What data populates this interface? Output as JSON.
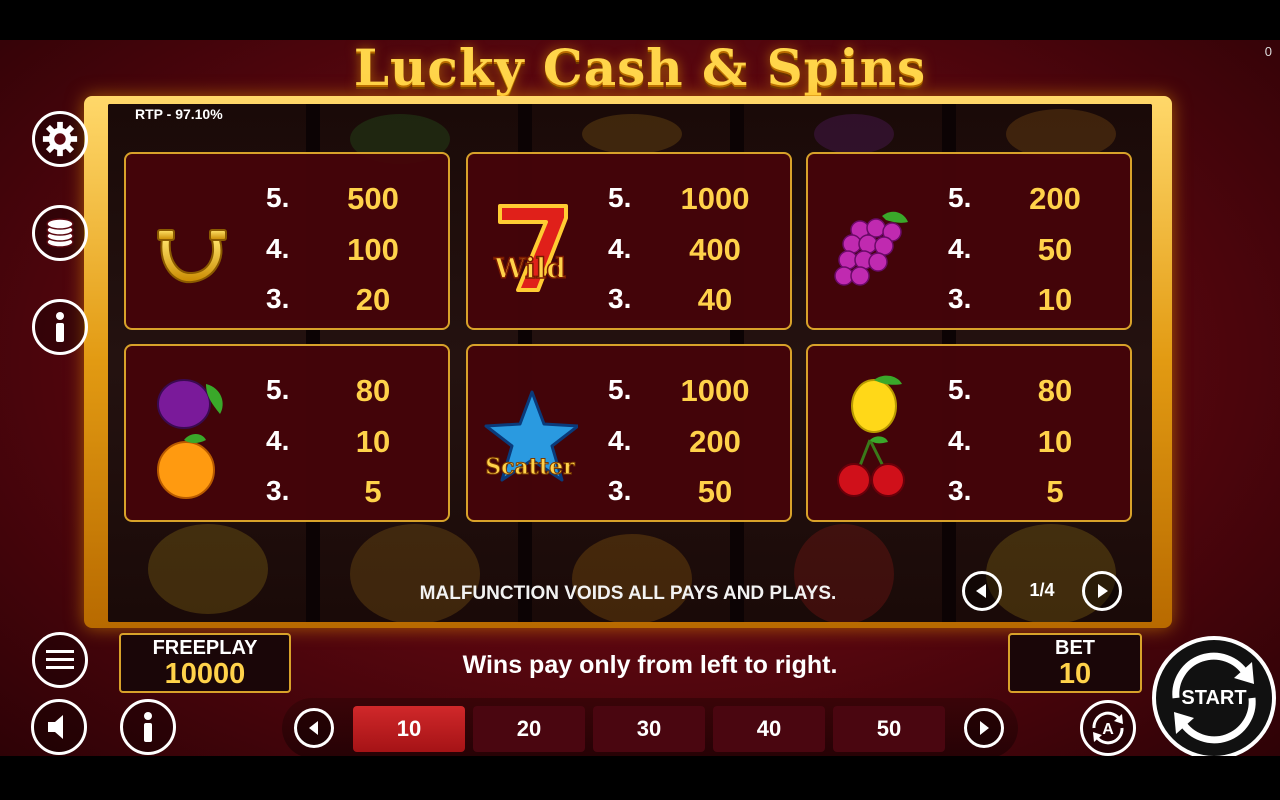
{
  "title": "Lucky Cash & Spins",
  "corner_counter": "0",
  "rtp": "RTP - 97.10%",
  "paytable": [
    {
      "symbol": "horseshoe",
      "rows": [
        {
          "count": "5.",
          "amount": "500"
        },
        {
          "count": "4.",
          "amount": "100"
        },
        {
          "count": "3.",
          "amount": "20"
        }
      ]
    },
    {
      "symbol": "wild-seven",
      "symbol_text": "Wild",
      "rows": [
        {
          "count": "5.",
          "amount": "1000"
        },
        {
          "count": "4.",
          "amount": "400"
        },
        {
          "count": "3.",
          "amount": "40"
        }
      ]
    },
    {
      "symbol": "grapes",
      "rows": [
        {
          "count": "5.",
          "amount": "200"
        },
        {
          "count": "4.",
          "amount": "50"
        },
        {
          "count": "3.",
          "amount": "10"
        }
      ]
    },
    {
      "symbol": "plum-orange",
      "rows": [
        {
          "count": "5.",
          "amount": "80"
        },
        {
          "count": "4.",
          "amount": "10"
        },
        {
          "count": "3.",
          "amount": "5"
        }
      ]
    },
    {
      "symbol": "scatter-star",
      "symbol_text": "Scatter",
      "rows": [
        {
          "count": "5.",
          "amount": "1000"
        },
        {
          "count": "4.",
          "amount": "200"
        },
        {
          "count": "3.",
          "amount": "50"
        }
      ]
    },
    {
      "symbol": "lemon-cherries",
      "rows": [
        {
          "count": "5.",
          "amount": "80"
        },
        {
          "count": "4.",
          "amount": "10"
        },
        {
          "count": "3.",
          "amount": "5"
        }
      ]
    }
  ],
  "malfunction_notice": "MALFUNCTION VOIDS ALL PAYS AND PLAYS.",
  "page_indicator": "1/4",
  "freeplay": {
    "label": "FREEPLAY",
    "value": "10000"
  },
  "bet": {
    "label": "BET",
    "value": "10"
  },
  "wins_message": "Wins pay only from left to right.",
  "bet_options": [
    "10",
    "20",
    "30",
    "40",
    "50"
  ],
  "selected_bet": "10",
  "start_label": "START",
  "colors": {
    "accent_gold": "#ffd24a",
    "frame_gold": "#d8a22a",
    "selected_red": "#c42024"
  }
}
